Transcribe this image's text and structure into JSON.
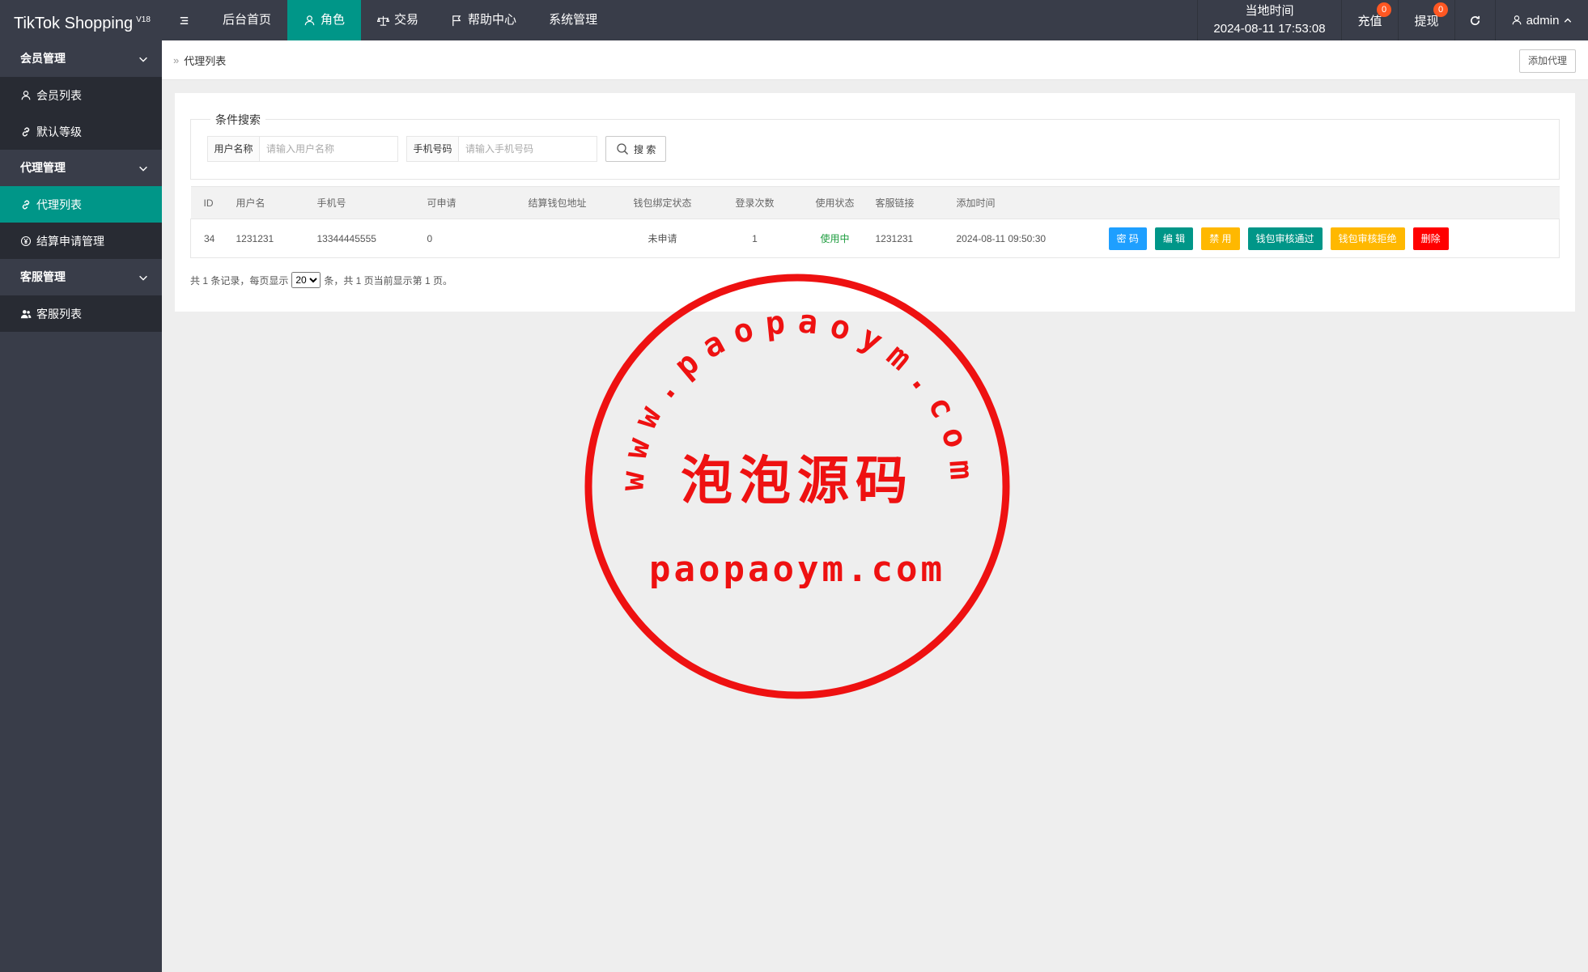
{
  "app": {
    "title": "TikTok Shopping",
    "version": "V18"
  },
  "nav": {
    "menu_icon": "hamburger-icon",
    "items": [
      {
        "label": "后台首页",
        "icon": ""
      },
      {
        "label": "角色",
        "icon": "user-icon"
      },
      {
        "label": "交易",
        "icon": "scale-icon"
      },
      {
        "label": "帮助中心",
        "icon": "flag-icon"
      },
      {
        "label": "系统管理",
        "icon": ""
      }
    ]
  },
  "topright": {
    "time_label": "当地时间",
    "time_value": "2024-08-11 17:53:08",
    "recharge_label": "充值",
    "recharge_count": "0",
    "withdraw_label": "提现",
    "withdraw_count": "0",
    "refresh_icon": "refresh-icon",
    "user": "admin"
  },
  "sidebar": {
    "groups": [
      {
        "label": "会员管理",
        "items": [
          {
            "label": "会员列表",
            "icon": "user-icon"
          },
          {
            "label": "默认等级",
            "icon": "link-icon"
          }
        ]
      },
      {
        "label": "代理管理",
        "items": [
          {
            "label": "代理列表",
            "icon": "link-icon"
          },
          {
            "label": "结算申请管理",
            "icon": "yen-icon"
          }
        ]
      },
      {
        "label": "客服管理",
        "items": [
          {
            "label": "客服列表",
            "icon": "users-icon"
          }
        ]
      }
    ]
  },
  "breadcrumb": {
    "current": "代理列表"
  },
  "add_button": "添加代理",
  "search": {
    "legend": "条件搜索",
    "username_label": "用户名称",
    "username_placeholder": "请输入用户名称",
    "phone_label": "手机号码",
    "phone_placeholder": "请输入手机号码",
    "button": "搜 索"
  },
  "table": {
    "headers": [
      "ID",
      "用户名",
      "手机号",
      "可申请",
      "结算钱包地址",
      "钱包绑定状态",
      "登录次数",
      "使用状态",
      "客服链接",
      "添加时间",
      ""
    ],
    "rows": [
      {
        "id": "34",
        "username": "1231231",
        "phone": "13344445555",
        "applicable": "0",
        "wallet": "",
        "wallet_status": "未申请",
        "logins": "1",
        "status": "使用中",
        "service_link": "1231231",
        "added": "2024-08-11 09:50:30",
        "actions": [
          "密 码",
          "编 辑",
          "禁 用",
          "钱包审核通过",
          "钱包审核拒绝",
          "删除"
        ]
      }
    ]
  },
  "pager": {
    "prefix": "共 1 条记录，每页显示",
    "page_size": "20",
    "suffix": "条，共 1 页当前显示第 1 页。"
  },
  "watermark": {
    "top_text": "www.paopaoym.com",
    "center_text": "泡泡源码",
    "bottom_text": "paopaoym.com",
    "color": "#ee1111"
  }
}
